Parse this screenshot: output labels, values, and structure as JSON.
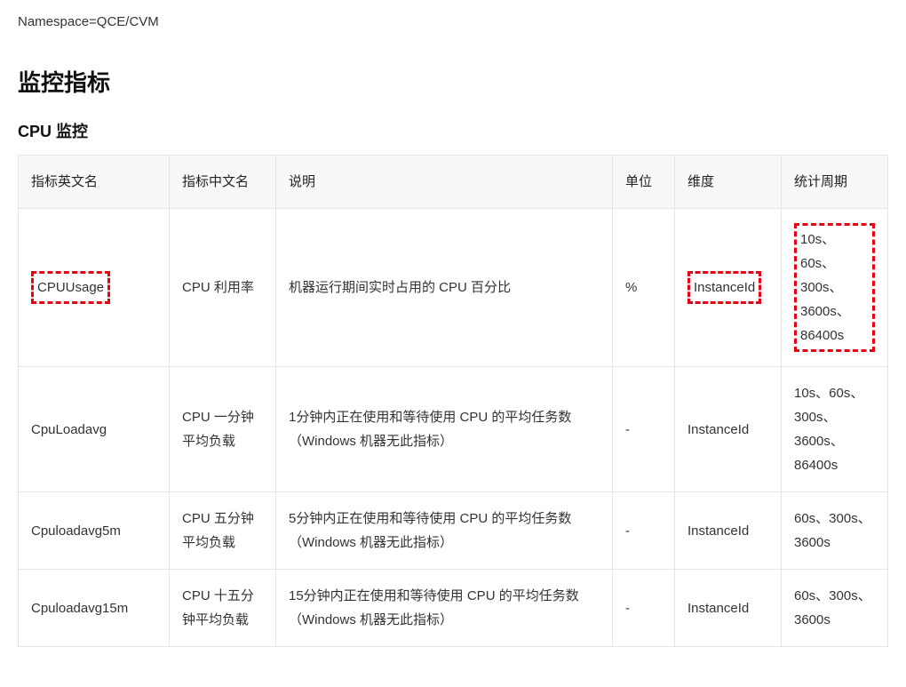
{
  "namespace_label": "Namespace=QCE/CVM",
  "section_title": "监控指标",
  "subsection_title": "CPU 监控",
  "headers": {
    "en": "指标英文名",
    "cn": "指标中文名",
    "desc": "说明",
    "unit": "单位",
    "dim": "维度",
    "period": "统计周期"
  },
  "rows": [
    {
      "en": "CPUUsage",
      "cn": "CPU 利用率",
      "desc": "机器运行期间实时占用的 CPU 百分比",
      "unit": "%",
      "dim": "InstanceId",
      "period": "10s、60s、300s、3600s、86400s",
      "hl_en": true,
      "hl_dim": true,
      "hl_period": true
    },
    {
      "en": "CpuLoadavg",
      "cn": "CPU 一分钟平均负载",
      "desc": "1分钟内正在使用和等待使用 CPU 的平均任务数（Windows 机器无此指标）",
      "unit": "-",
      "dim": "InstanceId",
      "period": "10s、60s、300s、3600s、86400s"
    },
    {
      "en": "Cpuloadavg5m",
      "cn": "CPU 五分钟平均负载",
      "desc": "5分钟内正在使用和等待使用 CPU 的平均任务数（Windows 机器无此指标）",
      "unit": "-",
      "dim": "InstanceId",
      "period": "60s、300s、3600s"
    },
    {
      "en": "Cpuloadavg15m",
      "cn": "CPU 十五分钟平均负载",
      "desc": "15分钟内正在使用和等待使用 CPU 的平均任务数（Windows 机器无此指标）",
      "unit": "-",
      "dim": "InstanceId",
      "period": "60s、300s、3600s"
    }
  ]
}
